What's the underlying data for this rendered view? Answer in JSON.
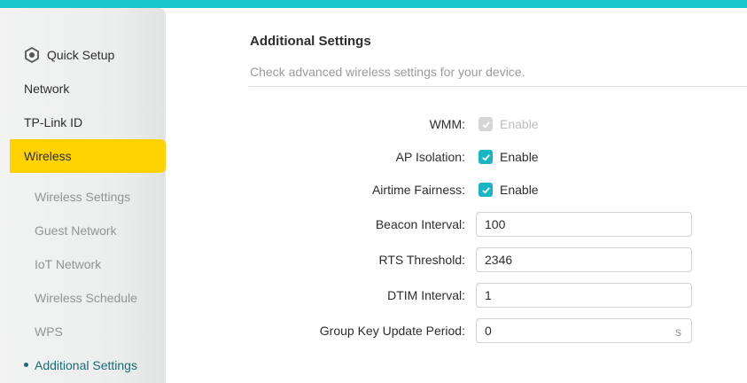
{
  "sidebar": {
    "items": [
      {
        "label": "Quick Setup",
        "icon": "gear-icon"
      },
      {
        "label": "Network"
      },
      {
        "label": "TP-Link ID"
      },
      {
        "label": "Wireless",
        "active": true
      }
    ],
    "sub_items": [
      {
        "label": "Wireless Settings"
      },
      {
        "label": "Guest Network"
      },
      {
        "label": "IoT Network"
      },
      {
        "label": "Wireless Schedule"
      },
      {
        "label": "WPS"
      },
      {
        "label": "Additional Settings",
        "active": true
      }
    ]
  },
  "main": {
    "title": "Additional Settings",
    "subtitle": "Check advanced wireless settings for your device.",
    "wmm": {
      "label": "WMM:",
      "option": "Enable",
      "checked": true,
      "disabled": true
    },
    "ap_isolation": {
      "label": "AP Isolation:",
      "option": "Enable",
      "checked": true
    },
    "airtime_fairness": {
      "label": "Airtime Fairness:",
      "option": "Enable",
      "checked": true
    },
    "beacon_interval": {
      "label": "Beacon Interval:",
      "value": "100"
    },
    "rts_threshold": {
      "label": "RTS Threshold:",
      "value": "2346"
    },
    "dtim_interval": {
      "label": "DTIM Interval:",
      "value": "1"
    },
    "group_key_update_period": {
      "label": "Group Key Update Period:",
      "value": "0",
      "suffix": "s"
    }
  },
  "colors": {
    "accent": "#19c7cb",
    "active_nav": "#ffd200",
    "checkbox": "#19b5c3",
    "active_sub_text": "#176b74"
  }
}
